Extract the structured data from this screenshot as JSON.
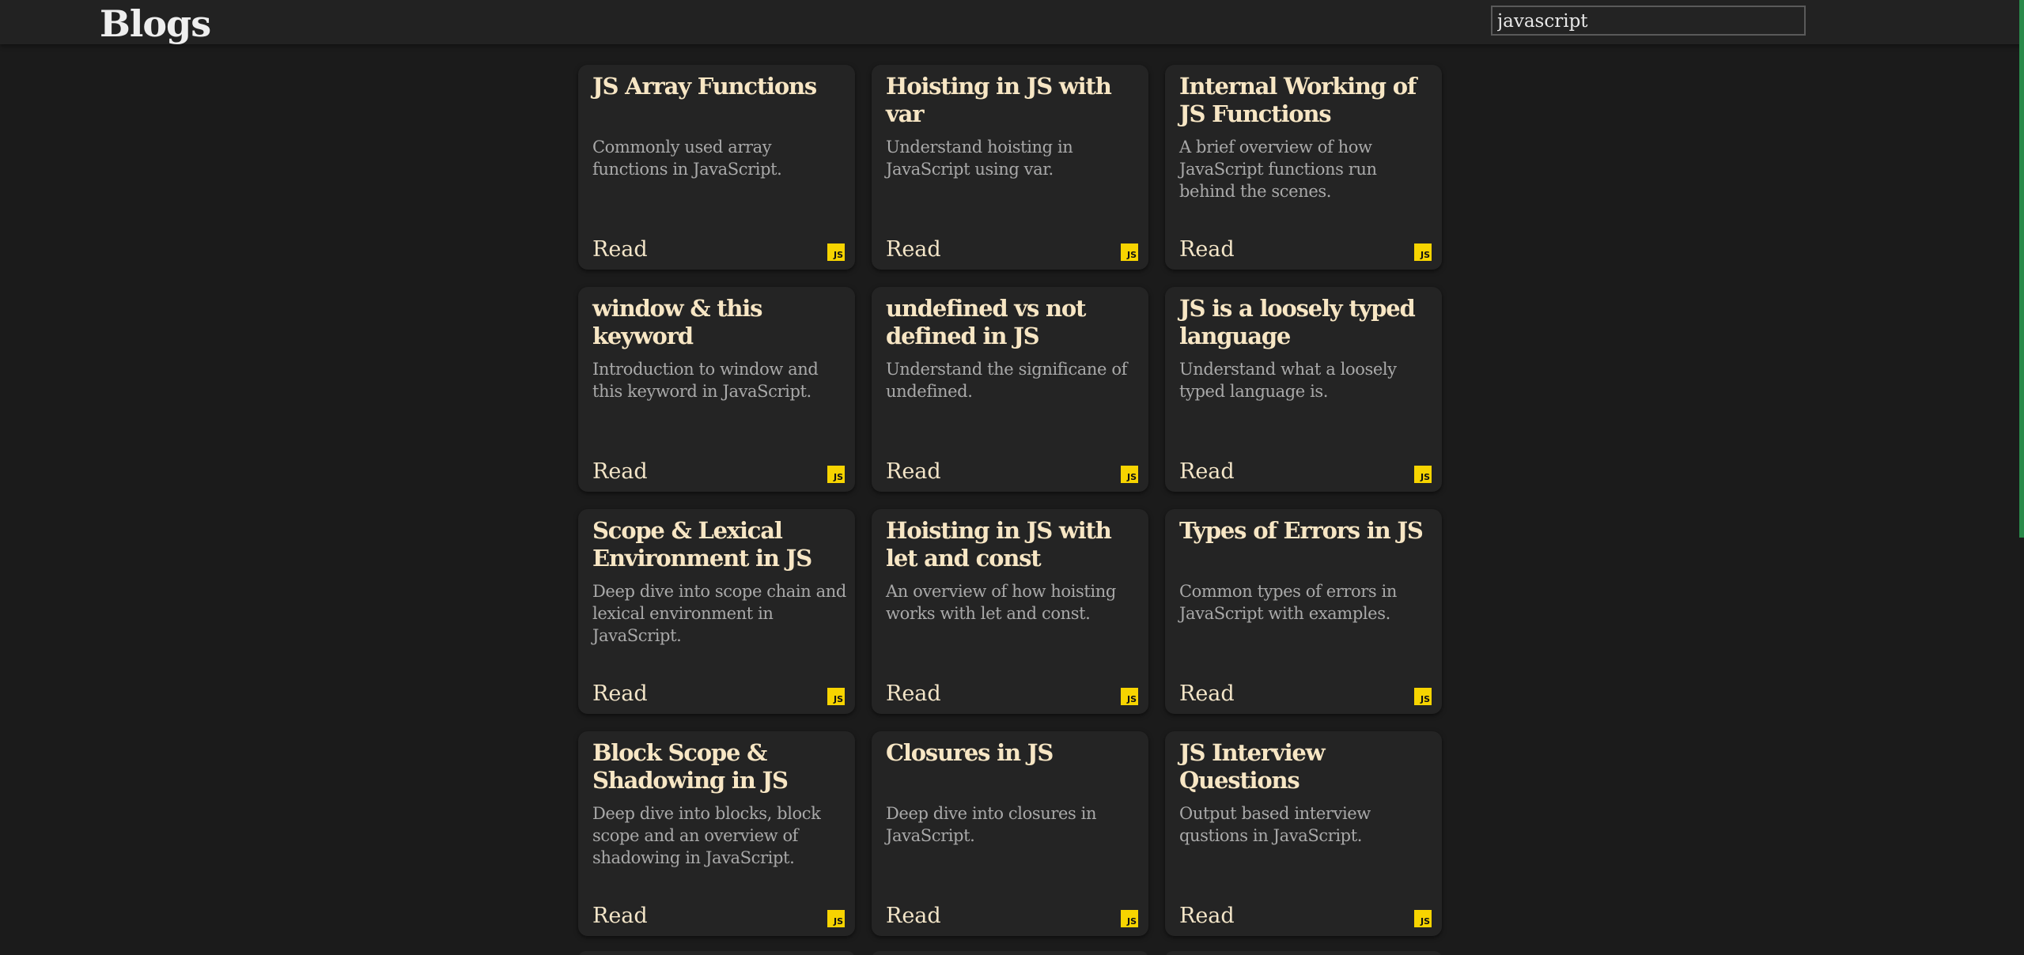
{
  "header": {
    "title": "Blogs",
    "search_value": "javascript"
  },
  "colors": {
    "background": "#1b1b1b",
    "topbar": "#222222",
    "card": "#242424",
    "title": "#f7e6c4",
    "description": "#a9a9a9",
    "js_badge": "#f7d400",
    "scrollbar": "#2a8a4a"
  },
  "cards": [
    {
      "title": "JS Array Functions",
      "description": "Commonly used array functions in JavaScript.",
      "link_label": "Read",
      "badge": "JS",
      "icon": "js-icon"
    },
    {
      "title": "Hoisting in JS with var",
      "description": "Understand hoisting in JavaScript using var.",
      "link_label": "Read",
      "badge": "JS",
      "icon": "js-icon"
    },
    {
      "title": "Internal Working of JS Functions",
      "description": "A brief overview of how JavaScript functions run behind the scenes.",
      "link_label": "Read",
      "badge": "JS",
      "icon": "js-icon"
    },
    {
      "title": "window & this keyword",
      "description": "Introduction to window and this keyword in JavaScript.",
      "link_label": "Read",
      "badge": "JS",
      "icon": "js-icon"
    },
    {
      "title": "undefined vs not defined in JS",
      "description": "Understand the significane of undefined.",
      "link_label": "Read",
      "badge": "JS",
      "icon": "js-icon"
    },
    {
      "title": "JS is a loosely typed language",
      "description": "Understand what a loosely typed language is.",
      "link_label": "Read",
      "badge": "JS",
      "icon": "js-icon"
    },
    {
      "title": "Scope & Lexical Environment in JS",
      "description": "Deep dive into scope chain and lexical environment in JavaScript.",
      "link_label": "Read",
      "badge": "JS",
      "icon": "js-icon"
    },
    {
      "title": "Hoisting in JS with let and const",
      "description": "An overview of how hoisting works with let and const.",
      "link_label": "Read",
      "badge": "JS",
      "icon": "js-icon"
    },
    {
      "title": "Types of Errors in JS",
      "description": "Common types of errors in JavaScript with examples.",
      "link_label": "Read",
      "badge": "JS",
      "icon": "js-icon"
    },
    {
      "title": "Block Scope & Shadowing in JS",
      "description": "Deep dive into blocks, block scope and an overview of shadowing in JavaScript.",
      "link_label": "Read",
      "badge": "JS",
      "icon": "js-icon"
    },
    {
      "title": "Closures in JS",
      "description": "Deep dive into closures in JavaScript.",
      "link_label": "Read",
      "badge": "JS",
      "icon": "js-icon"
    },
    {
      "title": "JS Interview Questions",
      "description": "Output based interview qustions in JavaScript.",
      "link_label": "Read",
      "badge": "JS",
      "icon": "js-icon"
    }
  ]
}
